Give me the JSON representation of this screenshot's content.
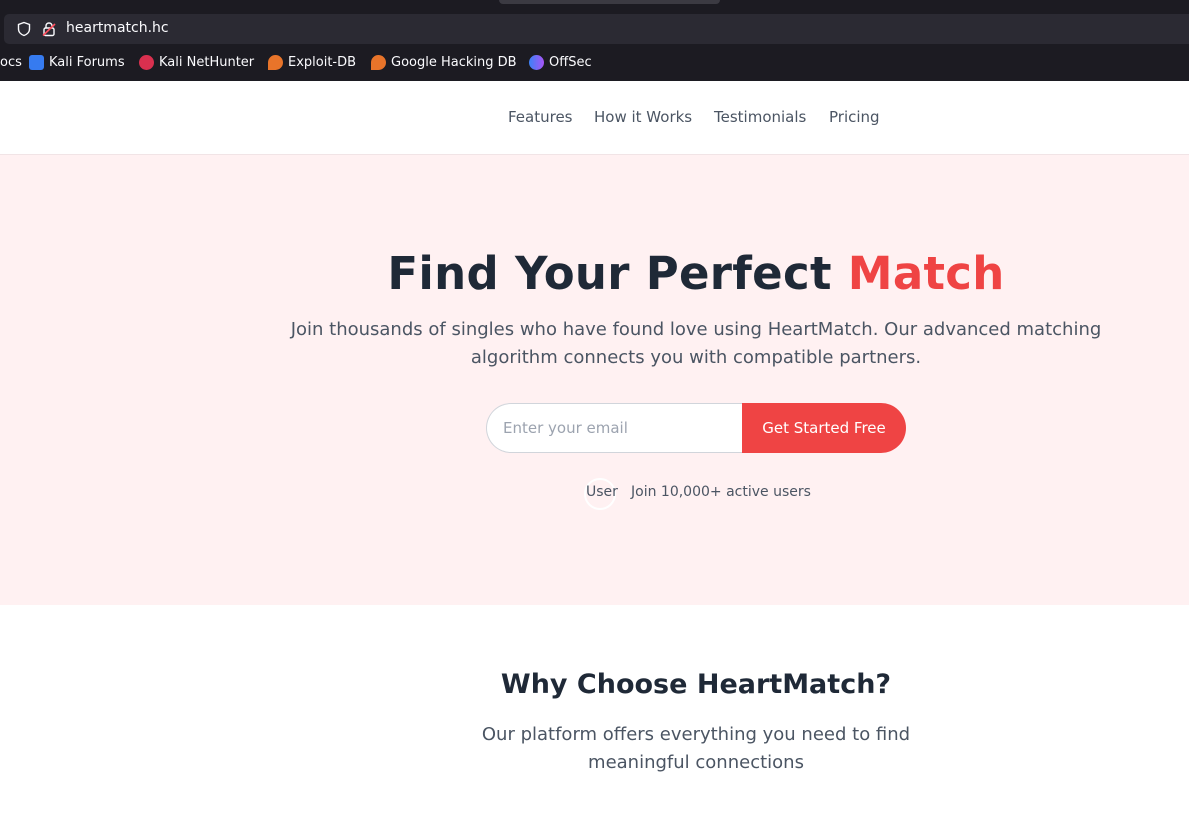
{
  "browser": {
    "url": "heartmatch.hc",
    "bookmarks": [
      {
        "label": "ocs",
        "icon": "docs-icon",
        "color": "#1c1b22"
      },
      {
        "label": "Kali Forums",
        "icon": "kali-forums-icon",
        "color": "#367bf0"
      },
      {
        "label": "Kali NetHunter",
        "icon": "kali-nethunter-icon",
        "color": "#d9304f"
      },
      {
        "label": "Exploit-DB",
        "icon": "exploit-db-icon",
        "color": "#e8742a"
      },
      {
        "label": "Google Hacking DB",
        "icon": "ghdb-icon",
        "color": "#e8742a"
      },
      {
        "label": "OffSec",
        "icon": "offsec-icon",
        "color": "#6f5cf1"
      }
    ]
  },
  "nav": {
    "links": [
      "Features",
      "How it Works",
      "Testimonials",
      "Pricing"
    ]
  },
  "hero": {
    "title_main": "Find Your Perfect",
    "title_accent": "Match",
    "subtitle": "Join thousands of singles who have found love using HeartMatch. Our advanced matching algorithm connects you with compatible partners.",
    "email_placeholder": "Enter your email",
    "cta_label": "Get Started Free",
    "avatar_alt": "User",
    "active_users": "Join 10,000+ active users"
  },
  "features": {
    "title": "Why Choose HeartMatch?",
    "subtitle": "Our platform offers everything you need to find meaningful connections"
  },
  "colors": {
    "accent": "#ef4444",
    "hero_bg": "#fff1f2",
    "heading": "#1f2937",
    "body_text": "#4b5563"
  }
}
